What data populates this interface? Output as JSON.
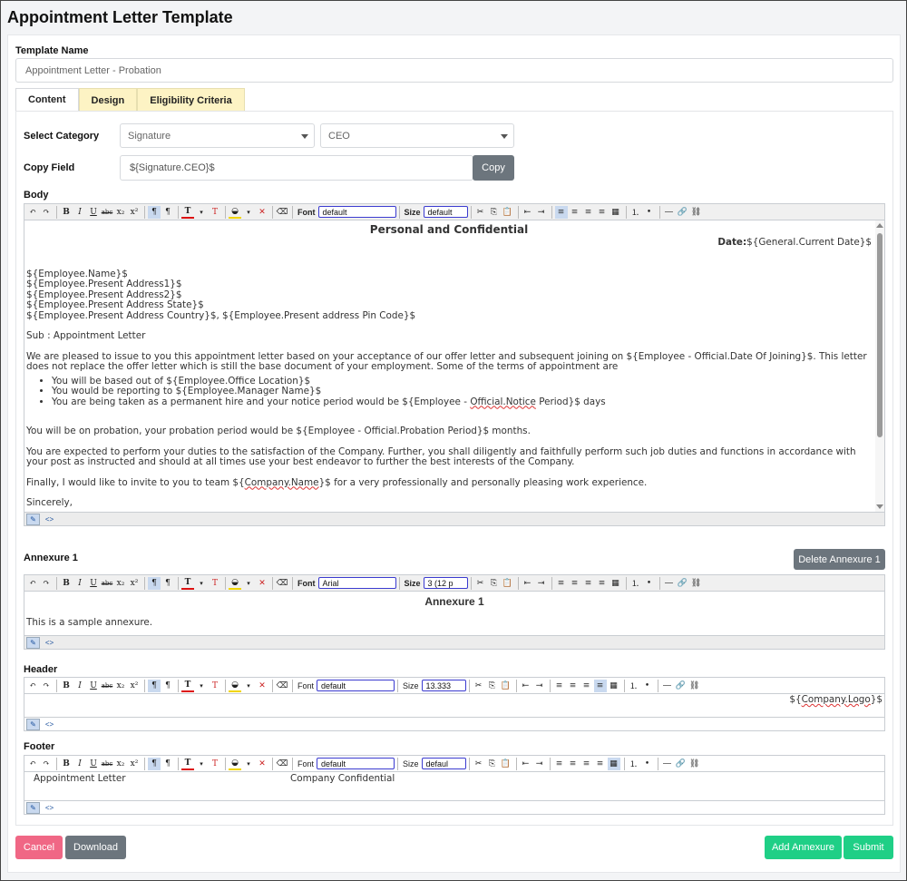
{
  "page": {
    "title": "Appointment Letter Template"
  },
  "template_name": {
    "label": "Template Name",
    "value": "Appointment Letter - Probation"
  },
  "tabs": [
    {
      "label": "Content"
    },
    {
      "label": "Design"
    },
    {
      "label": "Eligibility Criteria"
    }
  ],
  "category": {
    "label": "Select Category",
    "primary": "Signature",
    "secondary": "CEO"
  },
  "copy_field": {
    "label": "Copy Field",
    "value": "${Signature.CEO}$",
    "button": "Copy"
  },
  "body_editor": {
    "label": "Body",
    "font_label": "Font",
    "font_value": "default",
    "size_label": "Size",
    "size_value": "default",
    "heading": "Personal and Confidential",
    "date_label": "Date:",
    "date_value": "${General.Current Date}$",
    "address_lines": [
      "${Employee.Name}$",
      "${Employee.Present Address1}$",
      "${Employee.Present Address2}$",
      "${Employee.Present Address State}$",
      "${Employee.Present Address Country}$, ${Employee.Present address Pin Code}$"
    ],
    "subject": "Sub : Appointment Letter",
    "intro": "We are pleased to issue to you this appointment letter based on your acceptance of our offer letter and subsequent joining on ${Employee - Official.Date Of Joining}$. This letter does not replace the offer letter which is still the base document of your employment. Some of the terms of appointment are",
    "bullets": [
      "You will be based out of ${Employee.Office Location}$",
      "You would be reporting to ${Employee.Manager Name}$"
    ],
    "bullet3_pre": "You are being taken as a permanent hire and your notice period would be ${Employee - ",
    "bullet3_mark": "Official.Notice",
    "bullet3_post": " Period}$ days",
    "probation": "You will be on probation, your probation period would be ${Employee - Official.Probation Period}$ months.",
    "duties": "You are expected to perform your duties to the satisfaction of the Company. Further, you shall diligently and faithfully perform such job duties and functions in accordance with your post as instructed and should at all times use your best endeavor to further the best interests of the Company.",
    "finally_pre": "Finally, I would like to invite to you to team ${",
    "finally_mark": "Company.Name",
    "finally_post": "}$ for a very professionally and personally pleasing work experience.",
    "closing": "Sincerely,"
  },
  "annexure": {
    "label": "Annexure 1",
    "delete_button": "Delete Annexure 1",
    "font_label": "Font",
    "font_value": "Arial",
    "size_label": "Size",
    "size_value": "3 (12 p",
    "heading": "Annexure 1",
    "text": "This is a sample annexure."
  },
  "header_editor": {
    "label": "Header",
    "font_label": "Font",
    "font_value": "default",
    "size_label": "Size",
    "size_value": "13.333",
    "logo_pre": "${",
    "logo_mark": "Company.Logo",
    "logo_post": "}$"
  },
  "footer_editor": {
    "label": "Footer",
    "font_label": "Font",
    "font_value": "default",
    "size_label": "Size",
    "size_value": "defaul",
    "left": "Appointment Letter",
    "center": "Company Confidential"
  },
  "actions": {
    "cancel": "Cancel",
    "download": "Download",
    "add_annexure": "Add Annexure",
    "submit": "Submit"
  },
  "colors": {
    "cancel": "#f06785",
    "gray": "#6c757d",
    "green": "#1fcf86",
    "tab_inactive": "#fdf3c4"
  }
}
